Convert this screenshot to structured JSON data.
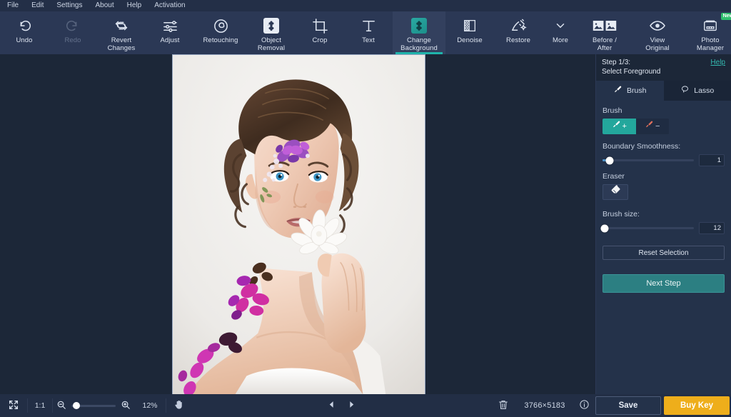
{
  "app": {
    "accent_teal": "#1fb4ab",
    "accent_orange": "#eeae1b",
    "panel_bg": "#24324a",
    "toolbar_bg": "#2b3855",
    "canvas_bg": "#1c2738"
  },
  "menubar": {
    "items": [
      {
        "label": "File"
      },
      {
        "label": "Edit"
      },
      {
        "label": "Settings"
      },
      {
        "label": "About"
      },
      {
        "label": "Help"
      },
      {
        "label": "Activation"
      }
    ]
  },
  "toolbar": {
    "left_items": [
      {
        "label": "Undo",
        "icon": "undo-icon",
        "state": "enabled"
      },
      {
        "label": "Redo",
        "icon": "redo-icon",
        "state": "disabled"
      },
      {
        "label": "Revert\nChanges",
        "line1": "Revert",
        "line2": "Changes",
        "icon": "revert-icon",
        "state": "enabled"
      }
    ],
    "tool_items": [
      {
        "label": "Adjust",
        "icon": "sliders-icon",
        "state": "enabled"
      },
      {
        "label": "Retouching",
        "icon": "retouch-icon",
        "state": "enabled"
      },
      {
        "line1": "Object",
        "line2": "Removal",
        "icon": "object-removal-icon",
        "state": "enabled"
      },
      {
        "label": "Crop",
        "icon": "crop-icon",
        "state": "enabled"
      },
      {
        "label": "Text",
        "icon": "text-icon",
        "state": "enabled"
      },
      {
        "line1": "Change",
        "line2": "Background",
        "icon": "change-background-icon",
        "state": "active"
      },
      {
        "label": "Denoise",
        "icon": "denoise-icon",
        "state": "enabled"
      },
      {
        "label": "Restore",
        "icon": "restore-icon",
        "state": "enabled"
      },
      {
        "label": "More",
        "icon": "chevron-down-icon",
        "state": "enabled"
      }
    ],
    "right_items": [
      {
        "line1": "Before /",
        "line2": "After",
        "icon": "before-after-icon",
        "state": "enabled"
      },
      {
        "line1": "View",
        "line2": "Original",
        "icon": "eye-icon",
        "state": "enabled"
      },
      {
        "line1": "Photo",
        "line2": "Manager",
        "icon": "photo-manager-icon",
        "state": "enabled",
        "badge": "New"
      }
    ]
  },
  "right_panel": {
    "step_line1": "Step 1/3:",
    "step_line2": "Select Foreground",
    "help_label": "Help",
    "tabs": [
      {
        "label": "Brush",
        "icon": "brush-icon",
        "active": true
      },
      {
        "label": "Lasso",
        "icon": "lasso-icon",
        "active": false
      }
    ],
    "brush_section_label": "Brush",
    "brush_add_label": "+",
    "brush_remove_label": "−",
    "boundary_label": "Boundary Smoothness:",
    "boundary_value": "1",
    "boundary_percent": 8,
    "eraser_label": "Eraser",
    "brush_size_label": "Brush size:",
    "brush_size_value": "12",
    "brush_size_percent": 2,
    "reset_label": "Reset Selection",
    "next_label": "Next Step"
  },
  "bottombar": {
    "fit_icon": "fit-screen-icon",
    "one_to_one_label": "1:1",
    "zoom_out_icon": "zoom-out-icon",
    "zoom_in_icon": "zoom-in-icon",
    "zoom_label": "12%",
    "zoom_percent": 12,
    "hand_icon": "hand-tool-icon",
    "prev_icon": "previous-image-icon",
    "next_icon": "next-image-icon",
    "delete_icon": "trash-icon",
    "dimensions": "3766×5183",
    "info_icon": "info-icon",
    "save_label": "Save",
    "buy_label": "Buy Key"
  },
  "canvas": {
    "image_alt": "portrait-photo-woman-with-flowers"
  }
}
